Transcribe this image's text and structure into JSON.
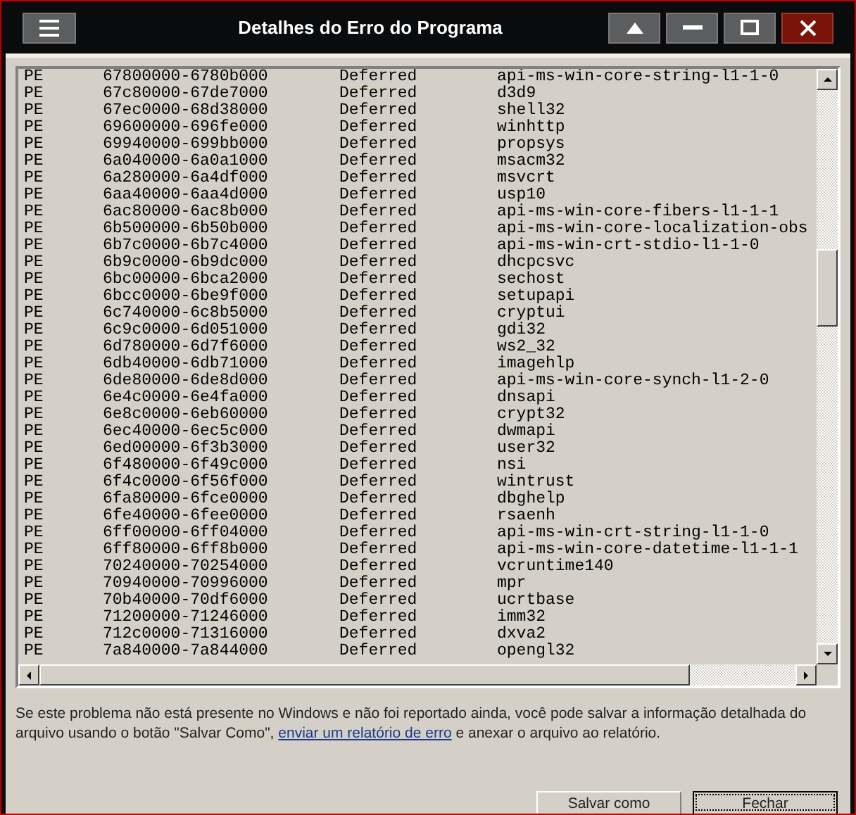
{
  "window": {
    "title": "Detalhes do Erro do Programa"
  },
  "modules": [
    {
      "type": "PE",
      "range": "67800000-6780b000",
      "status": "Deferred",
      "module": "api-ms-win-core-string-l1-1-0"
    },
    {
      "type": "PE",
      "range": "67c80000-67de7000",
      "status": "Deferred",
      "module": "d3d9"
    },
    {
      "type": "PE",
      "range": "67ec0000-68d38000",
      "status": "Deferred",
      "module": "shell32"
    },
    {
      "type": "PE",
      "range": "69600000-696fe000",
      "status": "Deferred",
      "module": "winhttp"
    },
    {
      "type": "PE",
      "range": "69940000-699bb000",
      "status": "Deferred",
      "module": "propsys"
    },
    {
      "type": "PE",
      "range": "6a040000-6a0a1000",
      "status": "Deferred",
      "module": "msacm32"
    },
    {
      "type": "PE",
      "range": "6a280000-6a4df000",
      "status": "Deferred",
      "module": "msvcrt"
    },
    {
      "type": "PE",
      "range": "6aa40000-6aa4d000",
      "status": "Deferred",
      "module": "usp10"
    },
    {
      "type": "PE",
      "range": "6ac80000-6ac8b000",
      "status": "Deferred",
      "module": "api-ms-win-core-fibers-l1-1-1"
    },
    {
      "type": "PE",
      "range": "6b500000-6b50b000",
      "status": "Deferred",
      "module": "api-ms-win-core-localization-obs"
    },
    {
      "type": "PE",
      "range": "6b7c0000-6b7c4000",
      "status": "Deferred",
      "module": "api-ms-win-crt-stdio-l1-1-0"
    },
    {
      "type": "PE",
      "range": "6b9c0000-6b9dc000",
      "status": "Deferred",
      "module": "dhcpcsvc"
    },
    {
      "type": "PE",
      "range": "6bc00000-6bca2000",
      "status": "Deferred",
      "module": "sechost"
    },
    {
      "type": "PE",
      "range": "6bcc0000-6be9f000",
      "status": "Deferred",
      "module": "setupapi"
    },
    {
      "type": "PE",
      "range": "6c740000-6c8b5000",
      "status": "Deferred",
      "module": "cryptui"
    },
    {
      "type": "PE",
      "range": "6c9c0000-6d051000",
      "status": "Deferred",
      "module": "gdi32"
    },
    {
      "type": "PE",
      "range": "6d780000-6d7f6000",
      "status": "Deferred",
      "module": "ws2_32"
    },
    {
      "type": "PE",
      "range": "6db40000-6db71000",
      "status": "Deferred",
      "module": "imagehlp"
    },
    {
      "type": "PE",
      "range": "6de80000-6de8d000",
      "status": "Deferred",
      "module": "api-ms-win-core-synch-l1-2-0"
    },
    {
      "type": "PE",
      "range": "6e4c0000-6e4fa000",
      "status": "Deferred",
      "module": "dnsapi"
    },
    {
      "type": "PE",
      "range": "6e8c0000-6eb60000",
      "status": "Deferred",
      "module": "crypt32"
    },
    {
      "type": "PE",
      "range": "6ec40000-6ec5c000",
      "status": "Deferred",
      "module": "dwmapi"
    },
    {
      "type": "PE",
      "range": "6ed00000-6f3b3000",
      "status": "Deferred",
      "module": "user32"
    },
    {
      "type": "PE",
      "range": "6f480000-6f49c000",
      "status": "Deferred",
      "module": "nsi"
    },
    {
      "type": "PE",
      "range": "6f4c0000-6f56f000",
      "status": "Deferred",
      "module": "wintrust"
    },
    {
      "type": "PE",
      "range": "6fa80000-6fce0000",
      "status": "Deferred",
      "module": "dbghelp"
    },
    {
      "type": "PE",
      "range": "6fe40000-6fee0000",
      "status": "Deferred",
      "module": "rsaenh"
    },
    {
      "type": "PE",
      "range": "6ff00000-6ff04000",
      "status": "Deferred",
      "module": "api-ms-win-crt-string-l1-1-0"
    },
    {
      "type": "PE",
      "range": "6ff80000-6ff8b000",
      "status": "Deferred",
      "module": "api-ms-win-core-datetime-l1-1-1"
    },
    {
      "type": "PE",
      "range": "70240000-70254000",
      "status": "Deferred",
      "module": "vcruntime140"
    },
    {
      "type": "PE",
      "range": "70940000-70996000",
      "status": "Deferred",
      "module": "mpr"
    },
    {
      "type": "PE",
      "range": "70b40000-70df6000",
      "status": "Deferred",
      "module": "ucrtbase"
    },
    {
      "type": "PE",
      "range": "71200000-71246000",
      "status": "Deferred",
      "module": "imm32"
    },
    {
      "type": "PE",
      "range": "712c0000-71316000",
      "status": "Deferred",
      "module": "dxva2"
    },
    {
      "type": "PE",
      "range": "7a840000-7a844000",
      "status": "Deferred",
      "module": "opengl32"
    }
  ],
  "message": {
    "before": "Se este problema não está presente no Windows e não foi reportado ainda, você pode salvar a informação detalhada do arquivo usando o botão \"Salvar Como\",",
    "link": "enviar um relatório de erro",
    "after": "e anexar o arquivo ao relatório."
  },
  "buttons": [
    {
      "label": "Salvar como",
      "default": false
    },
    {
      "label": "Fechar",
      "default": true
    }
  ]
}
